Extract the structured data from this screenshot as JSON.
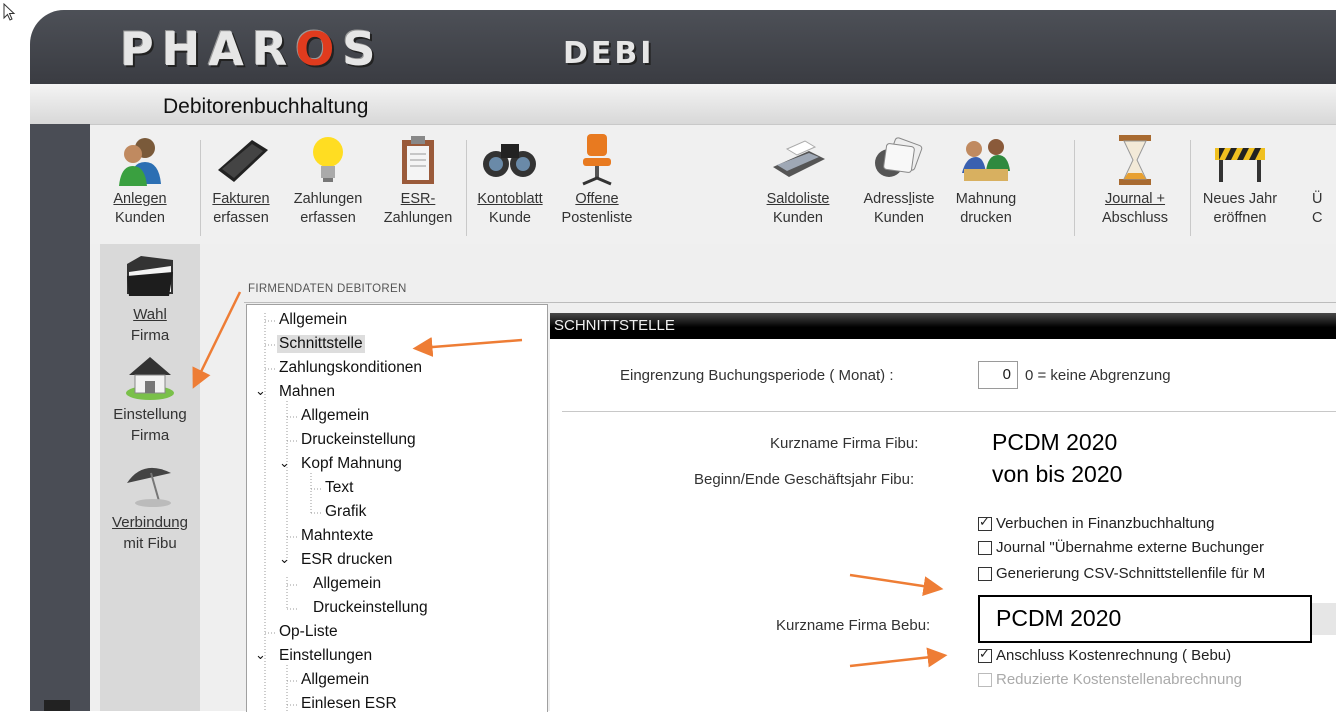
{
  "app": {
    "logo_main": "PHAR",
    "logo_o": "O",
    "logo_end": "S",
    "logo_sub": "DEBI",
    "subtitle": "Debitorenbuchhaltung"
  },
  "toolbar": [
    {
      "line1": "Anlegen",
      "line2": "Kunden",
      "icon": "users-icon"
    },
    {
      "line1": "Fakturen",
      "line2": "erfassen",
      "icon": "keyboard-icon"
    },
    {
      "line1": "Zahlungen",
      "line2": "erfassen",
      "icon": "lightbulb-icon"
    },
    {
      "line1": "ESR-",
      "line2": "Zahlungen",
      "icon": "clipboard-icon"
    },
    {
      "line1": "Kontoblatt",
      "line2": "Kunde",
      "icon": "binoculars-icon"
    },
    {
      "line1": "Offene",
      "line2": "Postenliste",
      "icon": "office-chair-icon"
    },
    {
      "line1": "Saldoliste",
      "line2": "Kunden",
      "icon": "printer-icon"
    },
    {
      "line1": "Adressliste",
      "line2": "Kunden",
      "icon": "address-cards-icon"
    },
    {
      "line1": "Mahnung",
      "line2": "drucken",
      "icon": "meeting-icon"
    },
    {
      "line1": "Journal +",
      "line2": "Abschluss",
      "icon": "hourglass-icon"
    },
    {
      "line1": "Neues Jahr",
      "line2": "eröffnen",
      "icon": "barrier-icon"
    },
    {
      "line1": "Ü",
      "line2": "C",
      "icon": "partial-icon"
    }
  ],
  "sidebar": [
    {
      "line1": "Wahl",
      "line2": "Firma",
      "icon": "folder-icon"
    },
    {
      "line1": "Einstellung",
      "line2": "Firma",
      "icon": "house-icon"
    },
    {
      "line1": "Verbindung",
      "line2": "mit Fibu",
      "icon": "umbrella-icon"
    }
  ],
  "panel_title": "FIRMENDATEN DEBITOREN",
  "tree": [
    "Allgemein",
    "Schnittstelle",
    "Zahlungskonditionen",
    "Mahnen",
    "Allgemein",
    "Druckeinstellung",
    "Kopf Mahnung",
    "Text",
    "Grafik",
    "Mahntexte",
    "ESR drucken",
    "Allgemein",
    "Druckeinstellung",
    "Op-Liste",
    "Einstellungen",
    "Allgemein",
    "Einlesen ESR"
  ],
  "section_title": "SCHNITTSTELLE",
  "form": {
    "period_label": "Eingrenzung Buchungsperiode  ( Monat)  :",
    "period_value": "0",
    "period_hint": "0 = keine Abgrenzung",
    "fibu_name_label": "Kurzname Firma Fibu:",
    "fibu_name_value": "PCDM 2020",
    "fibu_year_label": "Beginn/Ende Geschäftsjahr Fibu:",
    "fibu_year_value": "von bis 2020",
    "cb_verbuchen": "Verbuchen in Finanzbuchhaltung",
    "cb_journal": "Journal \"Übernahme externe Buchunger",
    "cb_csv": "Generierung CSV-Schnittstellenfile für M",
    "bebu_name_label": "Kurzname Firma Bebu:",
    "bebu_name_value": "PCDM 2020",
    "cb_kostenrechnung": "Anschluss Kostenrechnung  ( Bebu)",
    "cb_reduziert": "Reduzierte Kostenstellenabrechnung"
  },
  "colors": {
    "annotation_arrow": "#ee7d35",
    "logo_o": "#e03b1e",
    "banner": "#45484f"
  }
}
